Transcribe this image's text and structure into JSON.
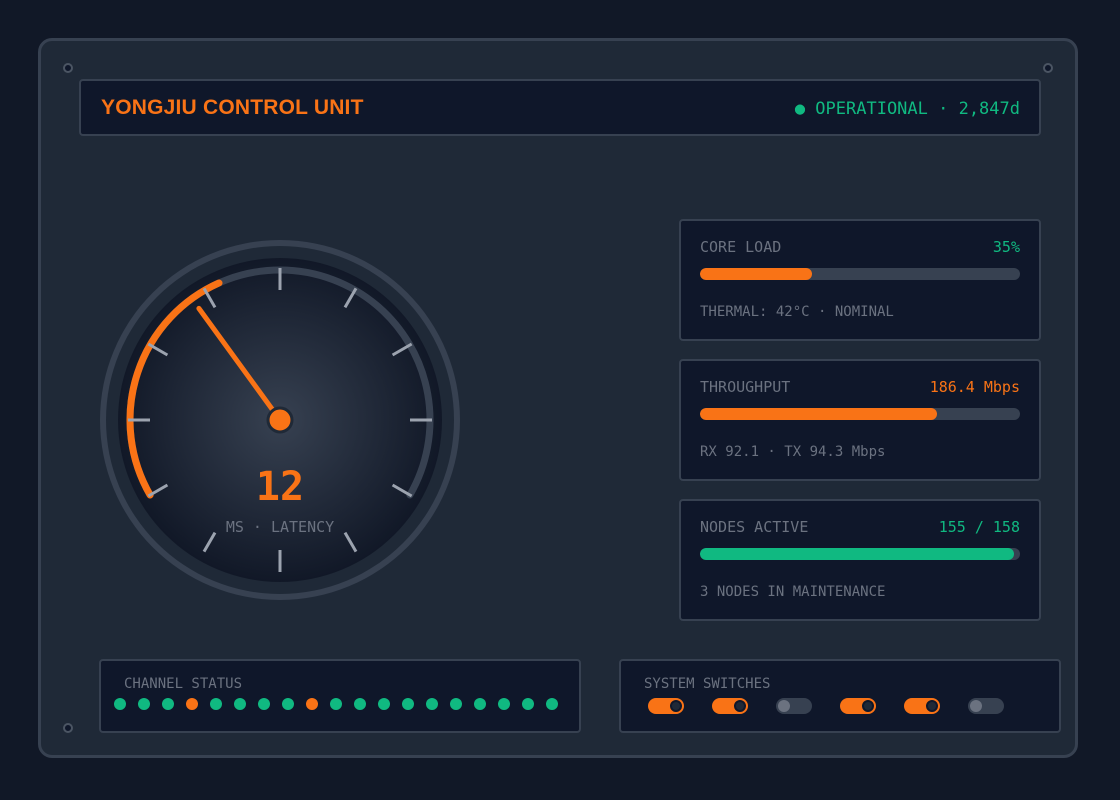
{
  "header": {
    "title": "YONGJIU CONTROL UNIT",
    "status": "● OPERATIONAL · 2,847d"
  },
  "gauge": {
    "value": "12",
    "unit_label": "MS · LATENCY",
    "scale_min": 0,
    "scale_max": 100,
    "value_fraction": 0.4
  },
  "metrics": [
    {
      "label": "CORE LOAD",
      "value": "35%",
      "percent": 35,
      "sub": "THERMAL: 42°C · NOMINAL",
      "value_color": "#10b981",
      "fill_color": "#f97316"
    },
    {
      "label": "THROUGHPUT",
      "value": "186.4 Mbps",
      "percent": 74,
      "sub": "RX 92.1 · TX 94.3 Mbps",
      "value_color": "#f97316",
      "fill_color": "#f97316"
    },
    {
      "label": "NODES ACTIVE",
      "value": "155 / 158",
      "percent": 98,
      "sub": "3 NODES IN MAINTENANCE",
      "value_color": "#10b981",
      "fill_color": "#10b981"
    }
  ],
  "channel_status": {
    "label": "CHANNEL STATUS",
    "channels": [
      "ok",
      "ok",
      "ok",
      "warn",
      "ok",
      "ok",
      "ok",
      "ok",
      "warn",
      "ok",
      "ok",
      "ok",
      "ok",
      "ok",
      "ok",
      "ok",
      "ok",
      "ok",
      "ok"
    ]
  },
  "system_switches": {
    "label": "SYSTEM SWITCHES",
    "states": [
      true,
      true,
      false,
      true,
      true,
      false
    ]
  },
  "colors": {
    "accent": "#f97316",
    "ok": "#10b981",
    "warn": "#f97316",
    "track": "#374151",
    "muted": "#6b7280"
  }
}
